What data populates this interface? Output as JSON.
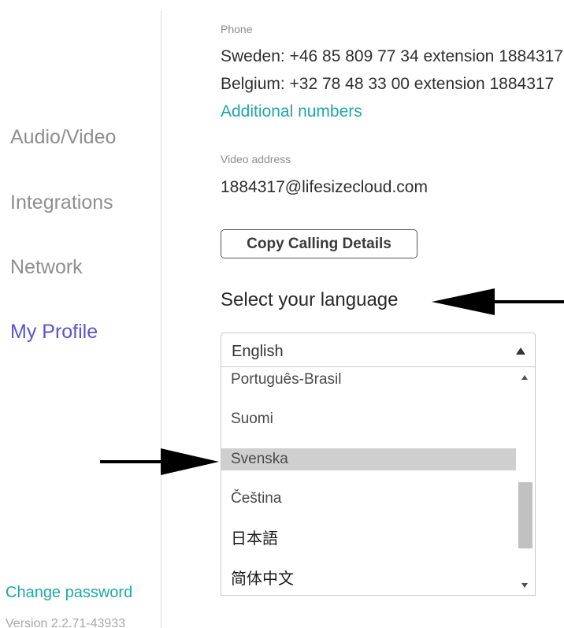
{
  "sidebar": {
    "items": [
      {
        "label": "Audio/Video",
        "active": false
      },
      {
        "label": "Integrations",
        "active": false
      },
      {
        "label": "Network",
        "active": false
      },
      {
        "label": "My Profile",
        "active": true
      }
    ],
    "change_password": "Change password",
    "version": "Version 2.2.71-43933"
  },
  "details": {
    "phone_label": "Phone",
    "phone_sweden": "Sweden: +46 85 809 77 34 extension 1884317",
    "phone_belgium": "Belgium: +32 78 48 33 00 extension 1884317",
    "additional_numbers": "Additional numbers",
    "video_label": "Video address",
    "video_address": "1884317@lifesizecloud.com",
    "copy_button": "Copy Calling Details"
  },
  "language": {
    "heading": "Select your language",
    "selected": "English",
    "options": [
      "Português-Brasil",
      "Suomi",
      "Svenska",
      "Čeština",
      "日本語",
      "简体中文"
    ],
    "highlighted": "Svenska"
  },
  "colors": {
    "accent_teal": "#1fa8a4",
    "active_nav": "#5a55c8",
    "nav_inactive": "#8f8f8f",
    "highlight_row": "#cfcfcf",
    "annotation_arrow": "#000000"
  },
  "icons": {
    "select_caret": "caret-up-icon",
    "scroll_up": "scroll-up-arrow-icon",
    "scroll_down": "scroll-down-arrow-icon",
    "annotation_heading": "annotation-arrow-left-icon",
    "annotation_option": "annotation-arrow-right-icon"
  }
}
